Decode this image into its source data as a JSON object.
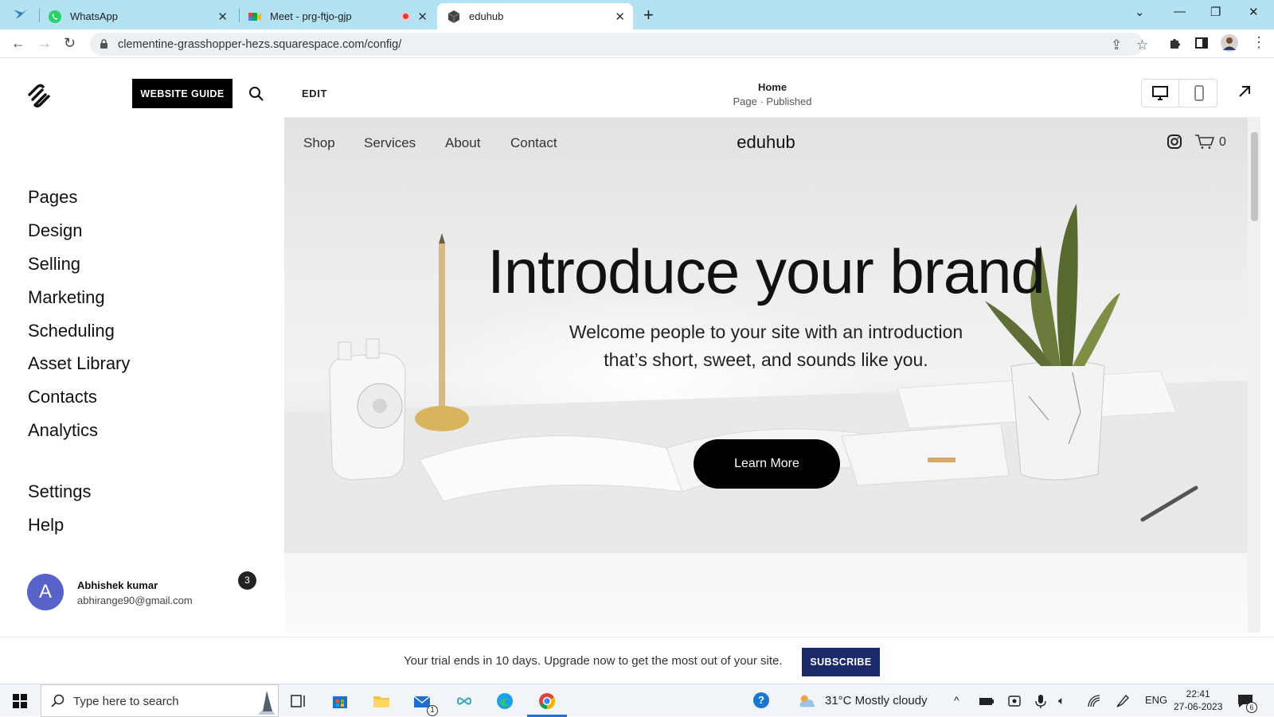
{
  "browser": {
    "tabs": [
      {
        "label": "WhatsApp"
      },
      {
        "label": "Meet - prg-ftjo-gjp"
      },
      {
        "label": "eduhub"
      }
    ],
    "url": "clementine-grasshopper-hezs.squarespace.com/config/"
  },
  "sidebar": {
    "guide_button": "WEBSITE GUIDE",
    "nav": [
      "Pages",
      "Design",
      "Selling",
      "Marketing",
      "Scheduling",
      "Asset Library",
      "Contacts",
      "Analytics"
    ],
    "nav_bottom": [
      "Settings",
      "Help"
    ],
    "user": {
      "initial": "A",
      "name": "Abhishek kumar",
      "email": "abhirange90@gmail.com",
      "notifications": "3"
    }
  },
  "editor": {
    "edit_label": "EDIT",
    "page_name": "Home",
    "page_status": "Page · Published"
  },
  "site": {
    "nav": [
      "Shop",
      "Services",
      "About",
      "Contact"
    ],
    "logo": "eduhub",
    "cart_count": "0",
    "hero_title": "Introduce your brand",
    "hero_body": "Welcome people to your site with an introduction that’s short, sweet, and sounds like you.",
    "hero_button": "Learn More"
  },
  "trial": {
    "text": "Your trial ends in 10 days. Upgrade now to get the most out of your site.",
    "button": "SUBSCRIBE"
  },
  "taskbar": {
    "search_placeholder": "Type here to search",
    "mail_badge": "1",
    "weather": "31°C  Mostly cloudy",
    "lang": "ENG",
    "time": "22:41",
    "date": "27-06-2023",
    "notif_count": "6"
  },
  "colors": {
    "tabstrip": "#b3e2f2",
    "subscribe": "#1b2a69",
    "avatar": "#5763c9"
  }
}
